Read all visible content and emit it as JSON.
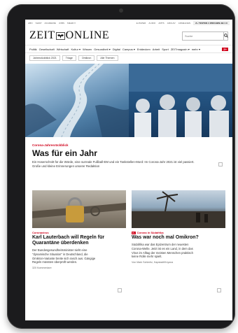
{
  "topbar": {
    "left": [
      "ABO",
      "SHOP",
      "AKADEMIE",
      "JOBS",
      "MEHR ▾"
    ],
    "right": [
      "E-PAPER",
      "AUDIO",
      "APPS",
      "ARCHIV",
      "ANMELDEN"
    ],
    "abo_label": "Z+ TESTEN 4 WOCHEN AB 1 €"
  },
  "logo": {
    "left": "ZEIT",
    "right": "ONLINE"
  },
  "search": {
    "placeholder": "Suche"
  },
  "nav": {
    "items": [
      "Politik",
      "Gesellschaft",
      "Wirtschaft",
      "Kultur ▾",
      "Wissen",
      "Gesundheit ▾",
      "Digital",
      "Campus ▾",
      "Entdecken",
      "Arbeit",
      "Sport",
      "ZEITmagazin ▾",
      "mehr ▾"
    ],
    "plus": "Z+"
  },
  "tags": [
    "Jahresrückblick 2021",
    "Triage",
    "Omikron",
    "Alle Themen"
  ],
  "lead": {
    "kicker": "Corona-Jahresrückblick",
    "title": "Was für ein Jahr",
    "teaser": "Ein Hoserschnitt für die Würde, eine surreale Fußball-EM und ein Tankstellen-Mord: Im Corona-Jahr 2021 ist viel passiert. Große und kleine Erinnerungen unserer Redaktion"
  },
  "cards": [
    {
      "kicker": "Coronavirus",
      "title": "Karl Lauterbach will Regeln für Quarantäne überdenken",
      "teaser": "Der Bundesgesundheitsminister sieht eine \"dynamische Situation\" in Deutschland, die Omikron-Variante breite sich rasch aus. Gängige Regeln müssten überprüft werden.",
      "meta": "320 Kommentare"
    },
    {
      "badge": "Z+",
      "kicker": "Corona in Südafrika",
      "title": "Was war noch mal Omikron?",
      "teaser": "Südafrika war das Epizentrum der neuesten Corona-Welle. Jetzt ist es ein Land, in dem das Virus im Alltag der meisten Menschen praktisch keine Rolle mehr spielt.",
      "meta": "Von Mark Schieritz, Kapstadt/Knysna"
    }
  ],
  "colors": {
    "accent": "#d0021b",
    "ink": "#111111"
  }
}
